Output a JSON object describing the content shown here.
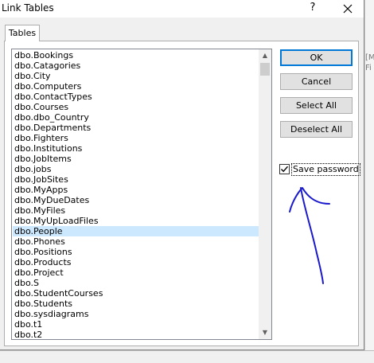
{
  "dialog": {
    "title": "Link Tables",
    "help_label": "?",
    "tab_label": "Tables"
  },
  "tables": [
    "dbo.Bookings",
    "dbo.Catagories",
    "dbo.City",
    "dbo.Computers",
    "dbo.ContactTypes",
    "dbo.Courses",
    "dbo.dbo_Country",
    "dbo.Departments",
    "dbo.Fighters",
    "dbo.Institutions",
    "dbo.JobItems",
    "dbo.jobs",
    "dbo.JobSites",
    "dbo.MyApps",
    "dbo.MyDueDates",
    "dbo.MyFiles",
    "dbo.MyUpLoadFiles",
    "dbo.People",
    "dbo.Phones",
    "dbo.Positions",
    "dbo.Products",
    "dbo.Project",
    "dbo.S",
    "dbo.StudentCourses",
    "dbo.Students",
    "dbo.sysdiagrams",
    "dbo.t1",
    "dbo.t2"
  ],
  "selected_table": "dbo.People",
  "buttons": {
    "ok": "OK",
    "cancel": "Cancel",
    "select_all": "Select All",
    "deselect_all": "Deselect All"
  },
  "save_password": {
    "label": "Save password",
    "checked": true
  },
  "colors": {
    "selection": "#cce8ff",
    "default_button_border": "#0078d7",
    "annotation_pen": "#1a1acc"
  }
}
